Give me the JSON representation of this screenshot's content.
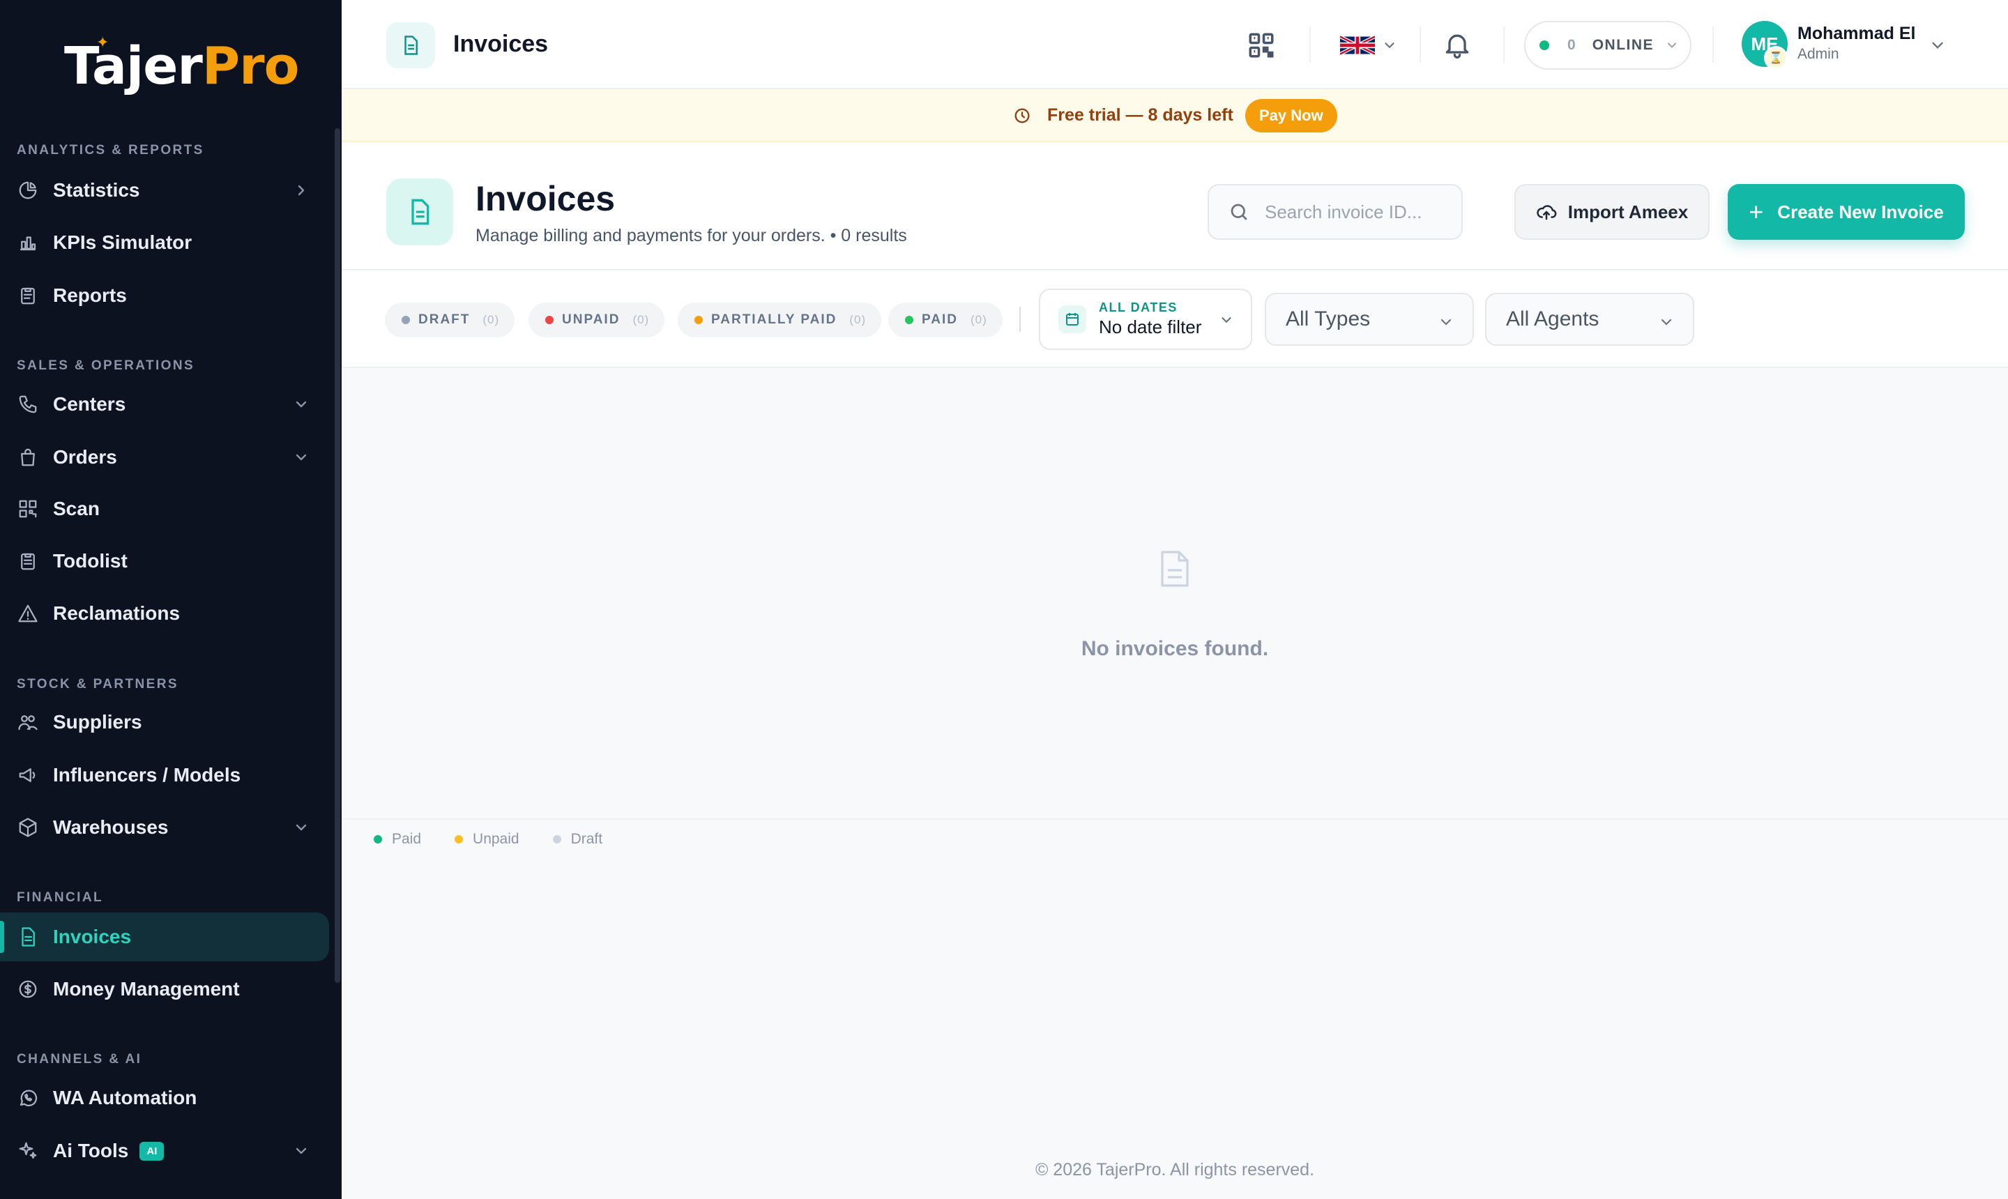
{
  "brand": {
    "logo_main": "Tajer",
    "logo_accent": "Pro"
  },
  "sidebar": {
    "sections": {
      "analytics": "ANALYTICS & REPORTS",
      "sales": "SALES & OPERATIONS",
      "stock": "STOCK & PARTNERS",
      "financial": "FINANCIAL",
      "channels": "CHANNELS & AI"
    },
    "items": {
      "statistics": "Statistics",
      "kpis": "KPIs Simulator",
      "reports": "Reports",
      "centers": "Centers",
      "orders": "Orders",
      "scan": "Scan",
      "todolist": "Todolist",
      "reclamations": "Reclamations",
      "suppliers": "Suppliers",
      "influencers": "Influencers / Models",
      "warehouses": "Warehouses",
      "invoices": "Invoices",
      "money": "Money Management",
      "wa": "WA Automation",
      "ai_tools": "Ai Tools",
      "ai_badge": "AI"
    }
  },
  "topbar": {
    "title": "Invoices",
    "online_count": "0",
    "online_label": "ONLINE",
    "user_initials": "ME",
    "user_name": "Mohammad El",
    "user_role": "Admin"
  },
  "banner": {
    "message": "Free trial — 8 days left",
    "pay_label": "Pay Now"
  },
  "page": {
    "title": "Invoices",
    "subtitle": "Manage billing and payments for your orders. • 0 results",
    "search_placeholder": "Search invoice ID...",
    "import_label": "Import Ameex",
    "create_label": "Create New Invoice"
  },
  "filters": {
    "chips": [
      {
        "label": "DRAFT",
        "count": "(0)",
        "color": "#94a3b8"
      },
      {
        "label": "UNPAID",
        "count": "(0)",
        "color": "#ef4444"
      },
      {
        "label": "PARTIALLY PAID",
        "count": "(0)",
        "color": "#f59e0b"
      },
      {
        "label": "PAID",
        "count": "(0)",
        "color": "#22c55e"
      }
    ],
    "date_key": "ALL DATES",
    "date_value": "No date filter",
    "types_value": "All Types",
    "agents_value": "All Agents"
  },
  "empty": {
    "message": "No invoices found."
  },
  "legend": [
    {
      "label": "Paid",
      "color": "#10b981"
    },
    {
      "label": "Unpaid",
      "color": "#fbbf24"
    },
    {
      "label": "Draft",
      "color": "#cbd5e1"
    }
  ],
  "footer": "© 2026 TajerPro. All rights reserved.",
  "colors": {
    "accent": "#14b8a6",
    "sidebar_bg": "#0c1220",
    "warning": "#f59e0b"
  }
}
